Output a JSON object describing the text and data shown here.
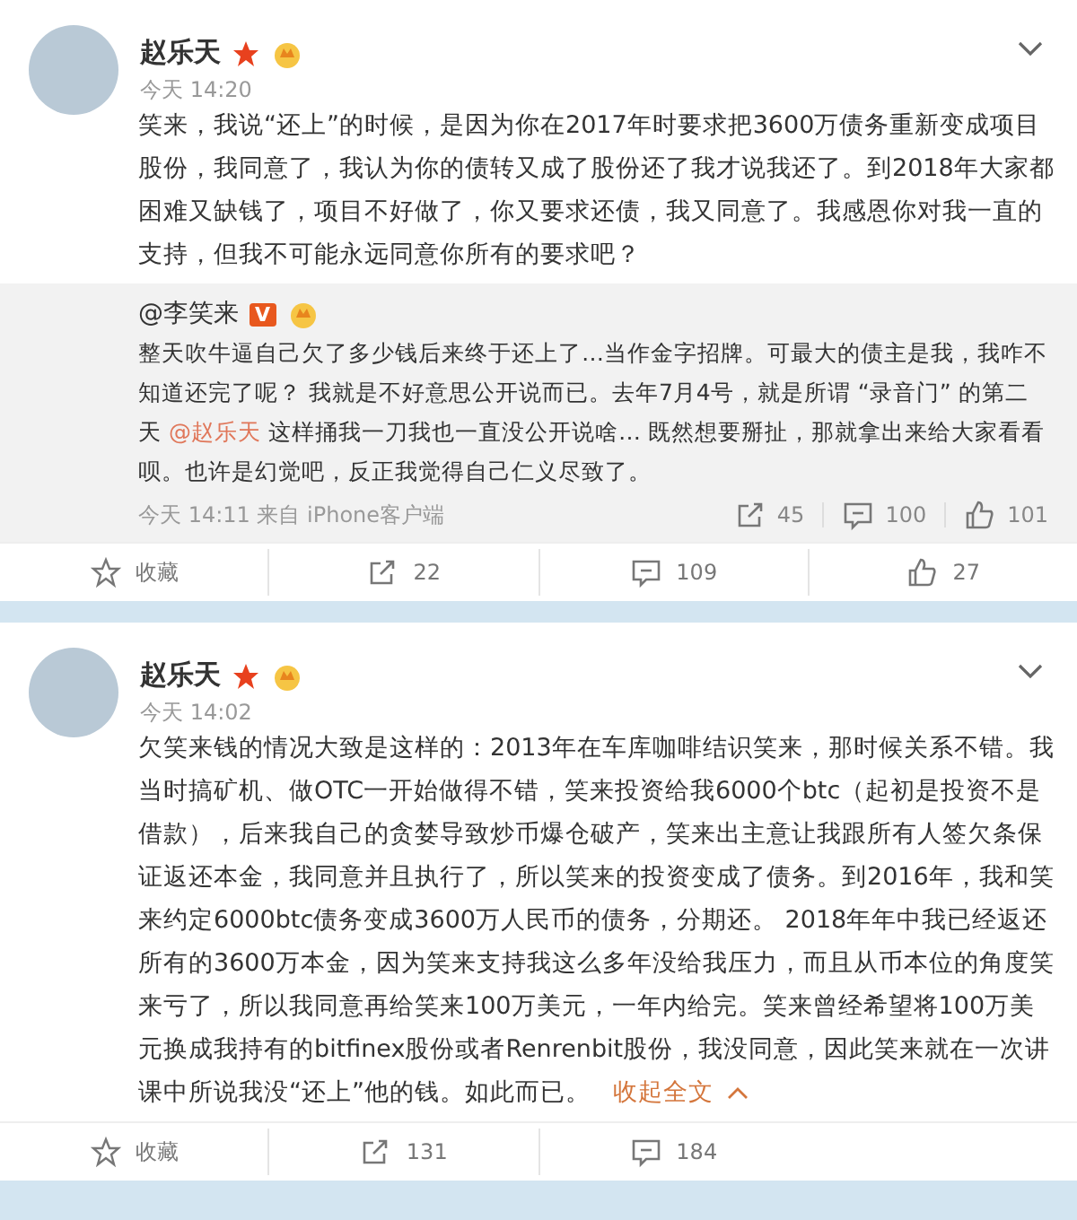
{
  "posts": [
    {
      "author": "赵乐天",
      "time": "今天 14:20",
      "text": [
        {
          "kind": "text",
          "value": "笑来，我说“还上”的时候，是因为你在2017年时要求把3600万债务重新变成项目股份，我同意了，我认为你的债转又成了股份还了我才说我还了。到2018年大家都困难又缺钱了，项目不好做了，你又要求还债，我又同意了。我感恩你对我一直的支持，但我不可能永远同意你所有的要求吧？"
        }
      ],
      "repost": {
        "author": "@李笑来",
        "badge": "V",
        "text": [
          {
            "kind": "text",
            "value": "整天吹牛逼自己欠了多少钱后来终于还上了…当作金字招牌。可最大的债主是我，我咋不知道还完了呢？ 我就是不好意思公开说而已。去年7月4号，就是所谓 “录音门” 的第二天 "
          },
          {
            "kind": "mention",
            "value": "@赵乐天"
          },
          {
            "kind": "text",
            "value": " 这样捅我一刀我也一直没公开说啥… 既然想要掰扯，那就拿出来给大家看看呗。也许是幻觉吧，反正我觉得自己仁义尽致了。"
          }
        ],
        "footer": "今天 14:11 来自 iPhone客户端",
        "reposts": "45",
        "comments": "100",
        "likes": "101"
      },
      "actions": [
        {
          "kind": "favorite",
          "label": "收藏"
        },
        {
          "kind": "repost",
          "label": "22"
        },
        {
          "kind": "comment",
          "label": "109"
        },
        {
          "kind": "like",
          "label": "27"
        }
      ]
    },
    {
      "author": "赵乐天",
      "time": "今天 14:02",
      "text": [
        {
          "kind": "text",
          "value": "欠笑来钱的情况大致是这样的：2013年在车库咖啡结识笑来，那时候关系不错。我当时搞矿机、做OTC一开始做得不错，笑来投资给我6000个btc（起初是投资不是借款），后来我自己的贪婪导致炒币爆仓破产，笑来出主意让我跟所有人签欠条保证返还本金，我同意并且执行了，所以笑来的投资变成了债务。到2016年，我和笑来约定6000btc债务变成3600万人民币的债务，分期还。 2018年年中我已经返还所有的3600万本金，因为笑来支持我这么多年没给我压力，而且从币本位的角度笑来亏了，所以我同意再给笑来100万美元，一年内给完。笑来曾经希望将100万美元换成我持有的bitfinex股份或者Renrenbit股份，我没同意，因此笑来就在一次讲课中所说我没“还上”他的钱。如此而已。 "
        }
      ],
      "collapse_link": "收起全文",
      "actions": [
        {
          "kind": "favorite",
          "label": "收藏"
        },
        {
          "kind": "repost",
          "label": "131"
        },
        {
          "kind": "comment",
          "label": "184"
        }
      ]
    }
  ]
}
